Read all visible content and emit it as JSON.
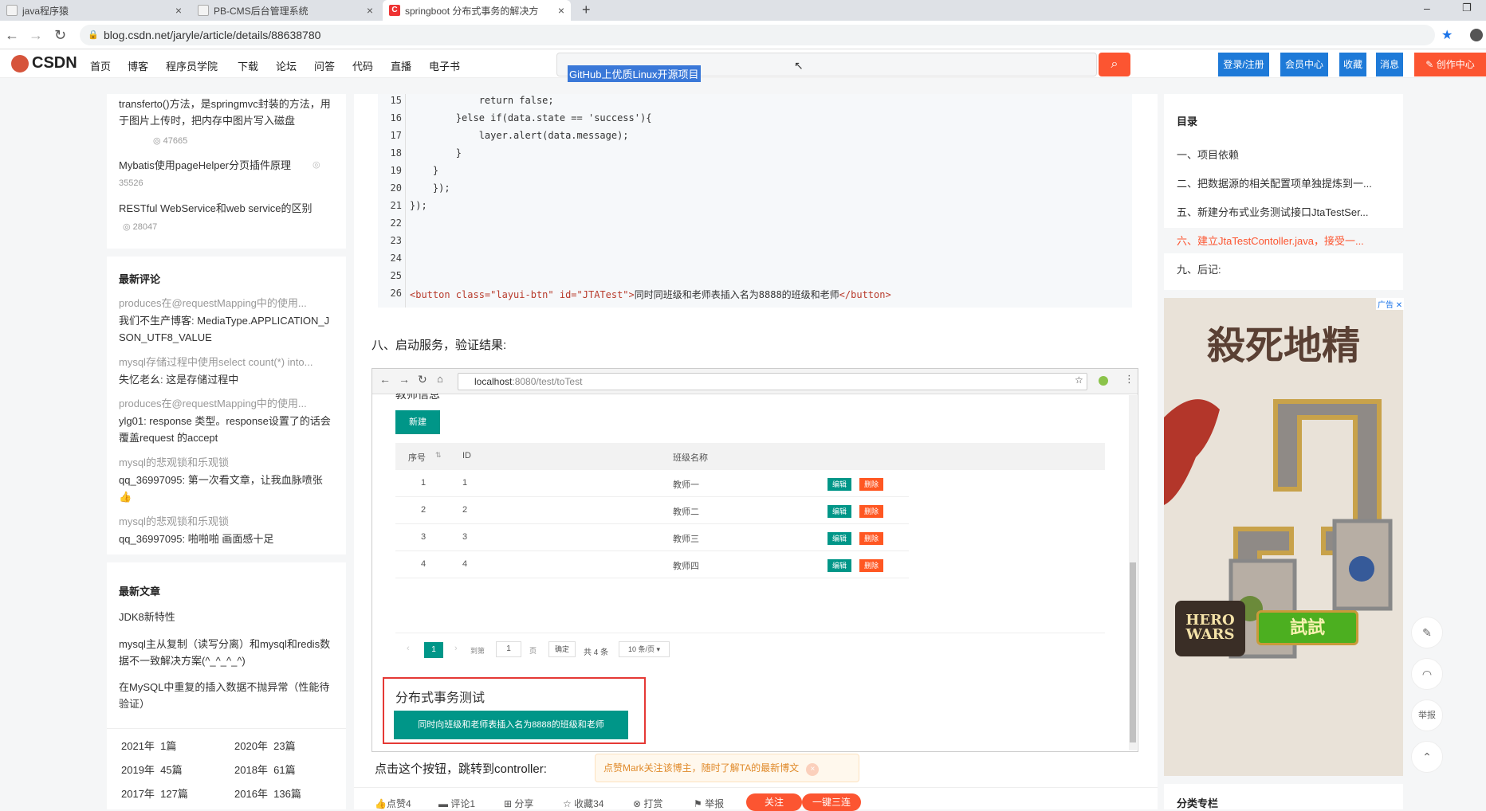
{
  "browser": {
    "tabs": [
      {
        "title": "java程序猿",
        "close": "×"
      },
      {
        "title": "PB-CMS后台管理系统",
        "close": "×"
      },
      {
        "title": "springboot 分布式事务的解决方",
        "close": "×"
      }
    ],
    "new_tab": "+",
    "url": "blog.csdn.net/jaryle/article/details/88638780",
    "win_min": "–",
    "win_max": "❐"
  },
  "site": {
    "logo": "CSDN",
    "nav": [
      "首页",
      "博客",
      "程序员学院",
      "下载",
      "论坛",
      "问答",
      "代码",
      "直播",
      "电子书"
    ],
    "search_query": "GitHub上优质Linux开源项目",
    "buttons": [
      "登录/注册",
      "会员中心",
      "收藏",
      "消息",
      "创作中心"
    ]
  },
  "left": {
    "hot": [
      {
        "title": "transferto()方法，是springmvc封装的方法，用于图片上传时，把内存中图片写入磁盘",
        "views": "47665"
      },
      {
        "title": "Mybatis使用pageHelper分页插件原理",
        "views": "35526"
      },
      {
        "title": "RESTful WebService和web service的区别",
        "views": "28047"
      }
    ],
    "comments_title": "最新评论",
    "comments": [
      {
        "article": "produces在@requestMapping中的使用...",
        "text": "我们不生产博客: MediaType.APPLICATION_JSON_UTF8_VALUE"
      },
      {
        "article": "mysql存储过程中使用select count(*) into...",
        "text": "失忆老幺: 这是存储过程中"
      },
      {
        "article": "produces在@requestMapping中的使用...",
        "text": "ylg01: response 类型。response设置了的话会覆盖request 的accept"
      },
      {
        "article": "mysql的悲观锁和乐观锁",
        "text": "qq_36997095: 第一次看文章，让我血脉喷张👍"
      },
      {
        "article": "mysql的悲观锁和乐观锁",
        "text": "qq_36997095: 啪啪啪 画面感十足"
      }
    ],
    "articles_title": "最新文章",
    "articles": [
      "JDK8新特性",
      "mysql主从复制（读写分离）和mysql和redis数据不一致解决方案(^_^_^_^)",
      "在MySQL中重复的插入数据不抛异常（性能待验证）"
    ],
    "archive": [
      [
        "2021年",
        "1篇"
      ],
      [
        "2020年",
        "23篇"
      ],
      [
        "2019年",
        "45篇"
      ],
      [
        "2018年",
        "61篇"
      ],
      [
        "2017年",
        "127篇"
      ],
      [
        "2016年",
        "136篇"
      ]
    ]
  },
  "code": {
    "lines": [
      {
        "n": "15",
        "t": "            return false;"
      },
      {
        "n": "16",
        "t": "        }else if(data.state == 'success'){"
      },
      {
        "n": "17",
        "t": "            layer.alert(data.message);"
      },
      {
        "n": "18",
        "t": "        }"
      },
      {
        "n": "19",
        "t": "    }"
      },
      {
        "n": "20",
        "t": "    });"
      },
      {
        "n": "21",
        "t": "});"
      },
      {
        "n": "22",
        "t": ""
      },
      {
        "n": "23",
        "t": ""
      },
      {
        "n": "24",
        "t": ""
      },
      {
        "n": "25",
        "t": ""
      }
    ],
    "line26_n": "26",
    "line26_open": "<button class=\"layui-btn\" id=\"JTATest\">",
    "line26_text": "同时同班级和老师表插入名为8888的班级和老师",
    "line26_close": "</button>"
  },
  "article": {
    "heading8": "八、启动服务，验证结果:",
    "bottom_text": "点击这个按钮，跳转到controller:",
    "follow_tip": "点赞Mark关注该博主，随时了解TA的最新博文"
  },
  "shot": {
    "url_host": "localhost",
    "url_rest": ":8080/test/toTest",
    "cut_title": "教师信息",
    "new_btn": "新建",
    "headers": [
      "序号",
      "ID",
      "班级名称"
    ],
    "rows": [
      [
        "1",
        "1",
        "教师一"
      ],
      [
        "2",
        "2",
        "教师二"
      ],
      [
        "3",
        "3",
        "教师三"
      ],
      [
        "4",
        "4",
        "教师四"
      ]
    ],
    "edit": "编辑",
    "del": "删除",
    "pager": {
      "page": "1",
      "goto": "到第",
      "input": "1",
      "unit": "页",
      "ok": "确定",
      "total": "共 4 条",
      "size": "10 条/页 ▾"
    },
    "section_title": "分布式事务测试",
    "action_btn": "同时向班级和老师表插入名为8888的班级和老师"
  },
  "toolbar": [
    "点赞4",
    "评论1",
    "分享",
    "收藏34",
    "打赏",
    "举报"
  ],
  "toolbar_follow": "关注",
  "toolbar_triple": "一键三连",
  "right": {
    "toc_title": "目录",
    "toc": [
      "一、项目依赖",
      "二、把数据源的相关配置项单独提炼到一...",
      "五、新建分布式业务测试接口JtaTestSer...",
      "六、建立JtaTestContoller.java，接受一...",
      "九、后记:"
    ],
    "ad_title": "殺死地精",
    "ad_logo": "HERO WARS",
    "ad_btn": "試試",
    "ad_tag": "广告",
    "category": "分类专栏",
    "report": "举报"
  },
  "colors": {
    "csdn_red": "#fc5531",
    "blue": "#1e7ad8",
    "teal": "#009688",
    "orange": "#ff5722"
  }
}
